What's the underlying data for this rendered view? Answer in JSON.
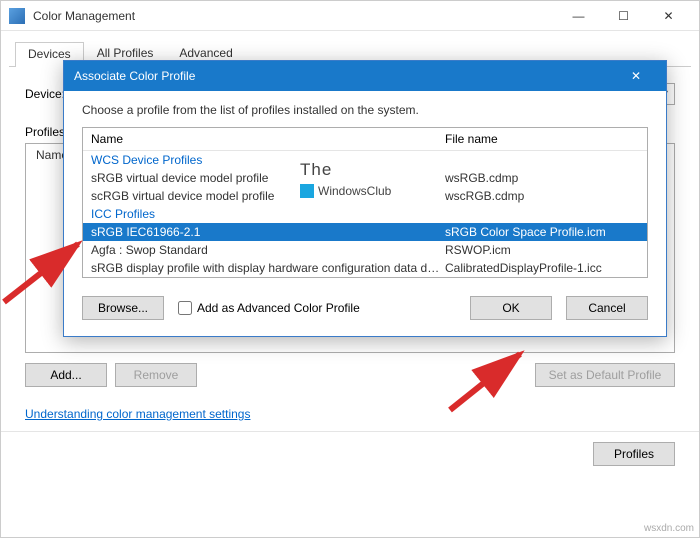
{
  "mainWindow": {
    "title": "Color Management",
    "tabs": [
      "Devices",
      "All Profiles",
      "Advanced"
    ],
    "deviceLabel": "Device:",
    "profilesLabel": "Profiles",
    "nameHeader": "Name",
    "buttons": {
      "add": "Add...",
      "remove": "Remove",
      "setDefault": "Set as Default Profile",
      "profiles": "Profiles"
    },
    "link": "Understanding color management settings"
  },
  "dialog": {
    "title": "Associate Color Profile",
    "instruction": "Choose a profile from the list of profiles installed on the system.",
    "columns": {
      "name": "Name",
      "file": "File name"
    },
    "groups": [
      {
        "label": "WCS Device Profiles",
        "rows": [
          {
            "name": "sRGB virtual device model profile",
            "file": "wsRGB.cdmp",
            "selected": false
          },
          {
            "name": "scRGB virtual device model profile",
            "file": "wscRGB.cdmp",
            "selected": false
          }
        ]
      },
      {
        "label": "ICC Profiles",
        "rows": [
          {
            "name": "sRGB IEC61966-2.1",
            "file": "sRGB Color Space Profile.icm",
            "selected": true
          },
          {
            "name": "Agfa : Swop Standard",
            "file": "RSWOP.icm",
            "selected": false
          },
          {
            "name": "sRGB display profile with display hardware configuration data deriv...",
            "file": "CalibratedDisplayProfile-1.icc",
            "selected": false
          }
        ]
      }
    ],
    "browse": "Browse...",
    "checkbox": "Add as Advanced Color Profile",
    "ok": "OK",
    "cancel": "Cancel"
  },
  "watermark": {
    "l1": "The",
    "l2": "WindowsClub"
  },
  "credit": "wsxdn.com"
}
